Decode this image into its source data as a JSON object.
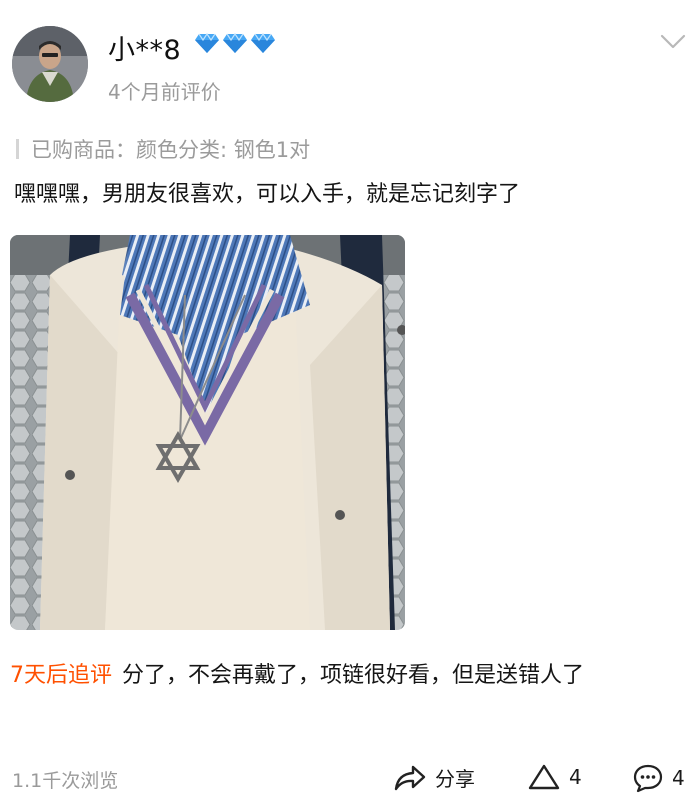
{
  "review": {
    "username": "小**8",
    "badge_icons": [
      "diamond-icon",
      "diamond-icon",
      "diamond-icon"
    ],
    "time": "4个月前评价",
    "purchased": "已购商品：颜色分类: 钢色1对",
    "text": "嘿嘿嘿，男朋友很喜欢，可以入手，就是忘记刻字了",
    "followup_tag": "7天后追评",
    "followup_text": "分了，不会再戴了，项链很好看，但是送错人了"
  },
  "footer": {
    "views": "1.1千次浏览",
    "share_label": "分享",
    "like_count": "4",
    "comment_count": "4"
  },
  "colors": {
    "accent": "#ff5000",
    "muted": "#9a9a9a",
    "badge": "#3a9cf0"
  }
}
